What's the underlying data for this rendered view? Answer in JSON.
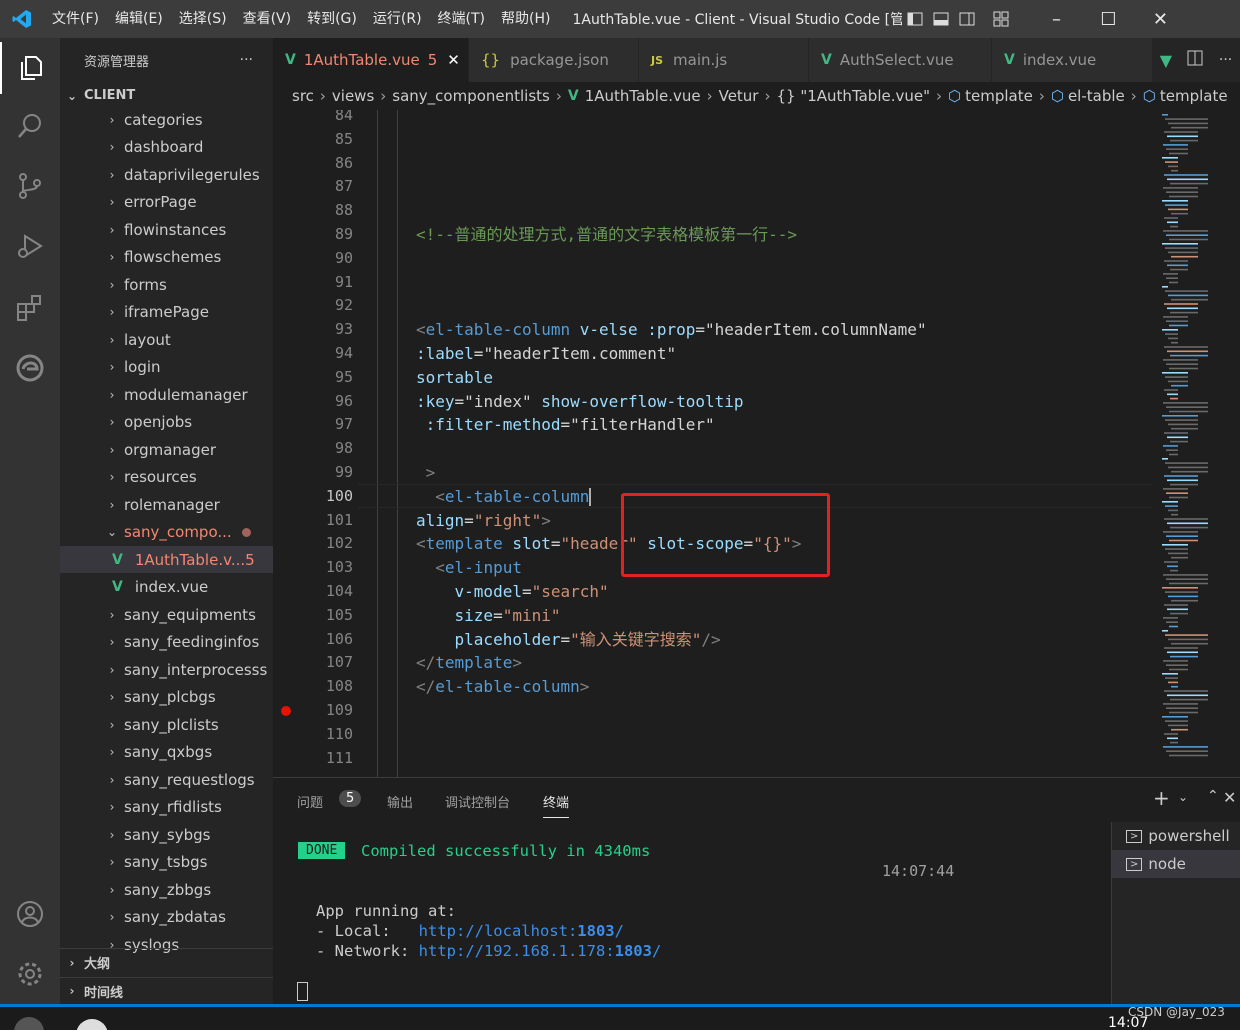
{
  "titlebar": {
    "menus": [
      "文件(F)",
      "编辑(E)",
      "选择(S)",
      "查看(V)",
      "转到(G)",
      "运行(R)",
      "终端(T)",
      "帮助(H)"
    ],
    "title": "1AuthTable.vue - Client - Visual Studio Code [管..."
  },
  "sidebar": {
    "title": "资源管理器",
    "more": "···",
    "section": "CLIENT",
    "items": [
      {
        "label": "categories",
        "type": "folder"
      },
      {
        "label": "dashboard",
        "type": "folder"
      },
      {
        "label": "dataprivilegerules",
        "type": "folder"
      },
      {
        "label": "errorPage",
        "type": "folder"
      },
      {
        "label": "flowinstances",
        "type": "folder"
      },
      {
        "label": "flowschemes",
        "type": "folder"
      },
      {
        "label": "forms",
        "type": "folder"
      },
      {
        "label": "iframePage",
        "type": "folder"
      },
      {
        "label": "layout",
        "type": "folder"
      },
      {
        "label": "login",
        "type": "folder"
      },
      {
        "label": "modulemanager",
        "type": "folder"
      },
      {
        "label": "openjobs",
        "type": "folder"
      },
      {
        "label": "orgmanager",
        "type": "folder"
      },
      {
        "label": "resources",
        "type": "folder"
      },
      {
        "label": "rolemanager",
        "type": "folder"
      },
      {
        "label": "sany_compo...",
        "type": "open-folder"
      },
      {
        "label": "1AuthTable.v...",
        "type": "file-active",
        "badge": "5"
      },
      {
        "label": "index.vue",
        "type": "file"
      },
      {
        "label": "sany_equipments",
        "type": "folder"
      },
      {
        "label": "sany_feedinginfos",
        "type": "folder"
      },
      {
        "label": "sany_interprocesss",
        "type": "folder"
      },
      {
        "label": "sany_plcbgs",
        "type": "folder"
      },
      {
        "label": "sany_plclists",
        "type": "folder"
      },
      {
        "label": "sany_qxbgs",
        "type": "folder"
      },
      {
        "label": "sany_requestlogs",
        "type": "folder"
      },
      {
        "label": "sany_rfidlists",
        "type": "folder"
      },
      {
        "label": "sany_sybgs",
        "type": "folder"
      },
      {
        "label": "sany_tsbgs",
        "type": "folder"
      },
      {
        "label": "sany_zbbgs",
        "type": "folder"
      },
      {
        "label": "sany_zbdatas",
        "type": "folder"
      },
      {
        "label": "syslogs",
        "type": "folder"
      }
    ],
    "outline": "大纲",
    "timeline": "时间线"
  },
  "tabs": [
    {
      "label": "1AuthTable.vue",
      "badge": "5",
      "icon": "V",
      "active": true
    },
    {
      "label": "package.json",
      "icon": "{}"
    },
    {
      "label": "main.js",
      "icon": "JS"
    },
    {
      "label": "AuthSelect.vue",
      "icon": "V"
    },
    {
      "label": "index.vue",
      "icon": "V"
    }
  ],
  "breadcrumb": [
    "src",
    "views",
    "sany_componentlists",
    "1AuthTable.vue",
    "Vetur",
    "{} \"1AuthTable.vue\"",
    "template",
    "el-table",
    "template"
  ],
  "code": [
    {
      "n": "84",
      "segs": []
    },
    {
      "n": "85",
      "segs": []
    },
    {
      "n": "86",
      "segs": []
    },
    {
      "n": "87",
      "segs": []
    },
    {
      "n": "88",
      "segs": []
    },
    {
      "n": "89",
      "segs": [
        {
          "t": "<!--普通的处理方式,普通的文字表格模板第一行-->",
          "c": "com"
        }
      ]
    },
    {
      "n": "90",
      "segs": []
    },
    {
      "n": "91",
      "segs": []
    },
    {
      "n": "92",
      "segs": []
    },
    {
      "n": "93",
      "segs": [
        {
          "t": "<",
          "c": "punc"
        },
        {
          "t": "el-table-column",
          "c": "tag"
        },
        {
          "t": " v-else :prop",
          "c": "attr"
        },
        {
          "t": "=",
          "c": "txt"
        },
        {
          "t": "\"headerItem.columnName\"",
          "c": "txt"
        }
      ]
    },
    {
      "n": "94",
      "segs": [
        {
          "t": ":label",
          "c": "attr"
        },
        {
          "t": "=",
          "c": "txt"
        },
        {
          "t": "\"headerItem.comment\"",
          "c": "txt"
        }
      ]
    },
    {
      "n": "95",
      "segs": [
        {
          "t": "sortable",
          "c": "attr"
        }
      ]
    },
    {
      "n": "96",
      "segs": [
        {
          "t": ":key",
          "c": "attr"
        },
        {
          "t": "=",
          "c": "txt"
        },
        {
          "t": "\"index\"",
          "c": "txt"
        },
        {
          "t": " show-overflow-tooltip",
          "c": "attr"
        }
      ]
    },
    {
      "n": "97",
      "segs": [
        {
          "t": " :filter-method",
          "c": "attr"
        },
        {
          "t": "=",
          "c": "txt"
        },
        {
          "t": "\"filterHandler\"",
          "c": "txt"
        }
      ]
    },
    {
      "n": "98",
      "segs": []
    },
    {
      "n": "99",
      "segs": [
        {
          "t": " >",
          "c": "punc"
        }
      ]
    },
    {
      "n": "100",
      "segs": [
        {
          "t": "  <",
          "c": "punc"
        },
        {
          "t": "el-table-column",
          "c": "tag"
        }
      ],
      "current": true
    },
    {
      "n": "101",
      "segs": [
        {
          "t": "align",
          "c": "attr"
        },
        {
          "t": "=",
          "c": "txt"
        },
        {
          "t": "\"right\"",
          "c": "str"
        },
        {
          "t": ">",
          "c": "punc"
        }
      ]
    },
    {
      "n": "102",
      "segs": [
        {
          "t": "<",
          "c": "punc"
        },
        {
          "t": "template",
          "c": "tag"
        },
        {
          "t": " slot",
          "c": "attr"
        },
        {
          "t": "=",
          "c": "txt"
        },
        {
          "t": "\"header\"",
          "c": "str"
        },
        {
          "t": " slot-scope",
          "c": "attr"
        },
        {
          "t": "=",
          "c": "txt"
        },
        {
          "t": "\"{}\"",
          "c": "str"
        },
        {
          "t": ">",
          "c": "punc"
        }
      ]
    },
    {
      "n": "103",
      "segs": [
        {
          "t": "  <",
          "c": "punc"
        },
        {
          "t": "el-input",
          "c": "tag"
        }
      ]
    },
    {
      "n": "104",
      "segs": [
        {
          "t": "    v-model",
          "c": "attr"
        },
        {
          "t": "=",
          "c": "txt"
        },
        {
          "t": "\"search\"",
          "c": "str"
        }
      ]
    },
    {
      "n": "105",
      "segs": [
        {
          "t": "    size",
          "c": "attr"
        },
        {
          "t": "=",
          "c": "txt"
        },
        {
          "t": "\"mini\"",
          "c": "str"
        }
      ]
    },
    {
      "n": "106",
      "segs": [
        {
          "t": "    placeholder",
          "c": "attr"
        },
        {
          "t": "=",
          "c": "txt"
        },
        {
          "t": "\"输入关键字搜索\"",
          "c": "str"
        },
        {
          "t": "/>",
          "c": "punc"
        }
      ]
    },
    {
      "n": "107",
      "segs": [
        {
          "t": "</",
          "c": "punc"
        },
        {
          "t": "template",
          "c": "tag"
        },
        {
          "t": ">",
          "c": "punc"
        }
      ]
    },
    {
      "n": "108",
      "segs": [
        {
          "t": "</",
          "c": "punc"
        },
        {
          "t": "el-table-column",
          "c": "tag"
        },
        {
          "t": ">",
          "c": "punc"
        }
      ]
    },
    {
      "n": "109",
      "segs": [],
      "breakpoint": true
    },
    {
      "n": "110",
      "segs": []
    },
    {
      "n": "111",
      "segs": []
    }
  ],
  "panel": {
    "tabs": [
      "问题",
      "输出",
      "调试控制台",
      "终端"
    ],
    "problems_count": "5",
    "done": "DONE",
    "compiled": "Compiled successfully in 4340ms",
    "time": "14:07:44",
    "app_running": "App running at:",
    "local_label": "- Local:   ",
    "local_url": "http://localhost:",
    "local_port": "1803",
    "network_label": "- Network: ",
    "network_url": "http://192.168.1.178:",
    "network_port": "1803",
    "slash": "/",
    "shells": [
      "powershell",
      "node"
    ]
  },
  "taskbar": {
    "clock": "14:07",
    "watermark": "CSDN @Jay_023"
  }
}
